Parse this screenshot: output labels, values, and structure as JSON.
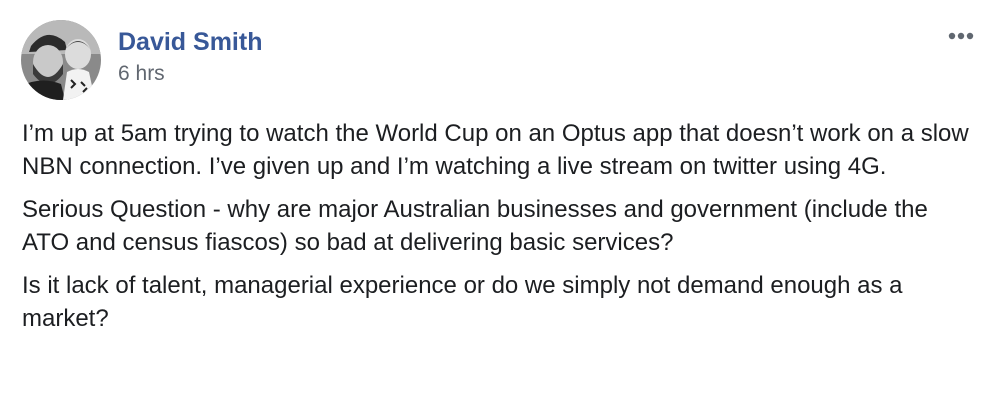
{
  "post": {
    "author": "David Smith",
    "timestamp": "6 hrs",
    "more_icon": "more-horizontal-icon",
    "avatar_icon": "profile-photo",
    "paragraphs": [
      "I’m up at 5am trying to watch the World Cup on an Optus app that doesn’t work on a slow NBN connection. I’ve given up and I’m watching a live stream on twitter using 4G.",
      "Serious Question - why are major Australian businesses and government (include the ATO and census fiascos) so bad at delivering basic services?",
      "Is it lack of talent, managerial experience or do we simply not demand enough as a market?"
    ]
  },
  "colors": {
    "author_link": "#385898",
    "secondary_text": "#616770",
    "body_text": "#1c1e21",
    "background": "#ffffff"
  }
}
